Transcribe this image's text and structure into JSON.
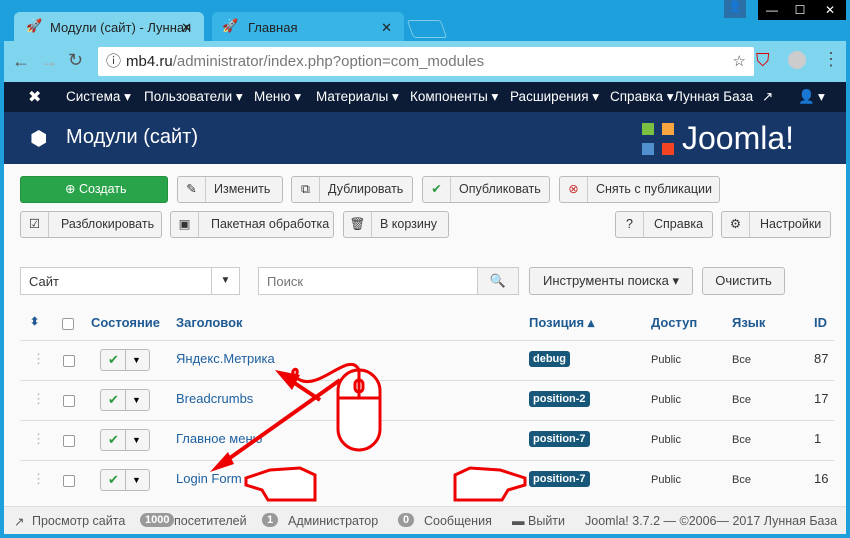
{
  "browser": {
    "tabs": [
      {
        "label": "Модули (сайт) - Лунная"
      },
      {
        "label": "Главная"
      }
    ],
    "url_host": "mb4.ru",
    "url_path": "/administrator/index.php?option=com_modules"
  },
  "nav": {
    "items": [
      "Система ▾",
      "Пользователи ▾",
      "Меню ▾",
      "Материалы ▾",
      "Компоненты ▾",
      "Расширения ▾",
      "Справка ▾"
    ],
    "site_link": "Лунная База",
    "user": "▾"
  },
  "header": {
    "title": "Модули (сайт)",
    "logo": "Joomla!"
  },
  "toolbar": {
    "new": "Создать",
    "edit": "Изменить",
    "duplicate": "Дублировать",
    "publish": "Опубликовать",
    "unpublish": "Снять с публикации",
    "checkin": "Разблокировать",
    "batch": "Пакетная обработка",
    "trash": "В корзину",
    "help": "Справка",
    "options": "Настройки"
  },
  "filters": {
    "client": "Сайт",
    "search_placeholder": "Поиск",
    "tools": "Инструменты поиска ▾",
    "clear": "Очистить"
  },
  "table": {
    "headers": {
      "status": "Состояние",
      "title": "Заголовок",
      "position": "Позиция ▴",
      "access": "Доступ",
      "language": "Язык",
      "id": "ID"
    },
    "rows": [
      {
        "title": "Яндекс.Метрика",
        "position": "debug",
        "access": "Public",
        "language": "Все",
        "id": "87"
      },
      {
        "title": "Breadcrumbs",
        "position": "position-2",
        "access": "Public",
        "language": "Все",
        "id": "17"
      },
      {
        "title": "Главное меню",
        "position": "position-7",
        "access": "Public",
        "language": "Все",
        "id": "1"
      },
      {
        "title": "Login Form",
        "position": "position-7",
        "access": "Public",
        "language": "Все",
        "id": "16"
      }
    ]
  },
  "status": {
    "view_site": "Просмотр сайта",
    "visitors_count": "1000",
    "visitors": "посетителей",
    "admins_count": "1",
    "admins": "Администратор",
    "messages_count": "0",
    "messages": "Сообщения",
    "logout": "Выйти",
    "copyright": "Joomla! 3.7.2 — ©2006— 2017 Лунная База"
  }
}
